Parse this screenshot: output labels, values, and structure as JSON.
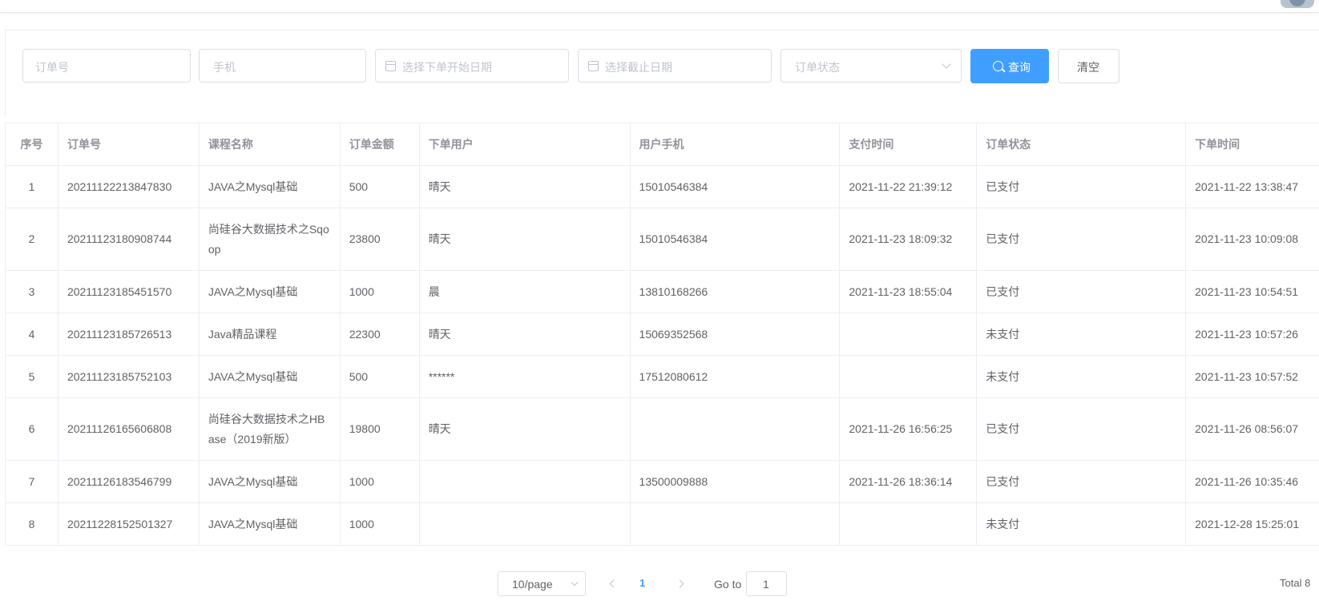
{
  "filters": {
    "order_no_placeholder": "订单号",
    "phone_placeholder": "手机",
    "start_date_placeholder": "选择下单开始日期",
    "end_date_placeholder": "选择截止日期",
    "status_placeholder": "订单状态",
    "query_label": "查询",
    "clear_label": "清空"
  },
  "table": {
    "columns": [
      "序号",
      "订单号",
      "课程名称",
      "订单金额",
      "下单用户",
      "用户手机",
      "支付时间",
      "订单状态",
      "下单时间"
    ],
    "rows": [
      [
        "1",
        "20211122213847830",
        "JAVA之Mysql基础",
        "500",
        "晴天",
        "15010546384",
        "2021-11-22 21:39:12",
        "已支付",
        "2021-11-22 13:38:47"
      ],
      [
        "2",
        "20211123180908744",
        "尚硅谷大数据技术之Sqoop",
        "23800",
        "晴天",
        "15010546384",
        "2021-11-23 18:09:32",
        "已支付",
        "2021-11-23 10:09:08"
      ],
      [
        "3",
        "20211123185451570",
        "JAVA之Mysql基础",
        "1000",
        "晨",
        "13810168266",
        "2021-11-23 18:55:04",
        "已支付",
        "2021-11-23 10:54:51"
      ],
      [
        "4",
        "20211123185726513",
        "Java精品课程",
        "22300",
        "晴天",
        "15069352568",
        "",
        "未支付",
        "2021-11-23 10:57:26"
      ],
      [
        "5",
        "20211123185752103",
        "JAVA之Mysql基础",
        "500",
        "******",
        "17512080612",
        "",
        "未支付",
        "2021-11-23 10:57:52"
      ],
      [
        "6",
        "20211126165606808",
        "尚硅谷大数据技术之HBase（2019新版）",
        "19800",
        "晴天",
        "",
        "2021-11-26 16:56:25",
        "已支付",
        "2021-11-26 08:56:07"
      ],
      [
        "7",
        "20211126183546799",
        "JAVA之Mysql基础",
        "1000",
        "",
        "13500009888",
        "2021-11-26 18:36:14",
        "已支付",
        "2021-11-26 10:35:46"
      ],
      [
        "8",
        "20211228152501327",
        "JAVA之Mysql基础",
        "1000",
        "",
        "",
        "",
        "未支付",
        "2021-12-28 15:25:01"
      ]
    ]
  },
  "pagination": {
    "page_size_label": "10/page",
    "current_page": "1",
    "goto_label": "Go to",
    "goto_value": "1",
    "total_label": "Total 8"
  }
}
